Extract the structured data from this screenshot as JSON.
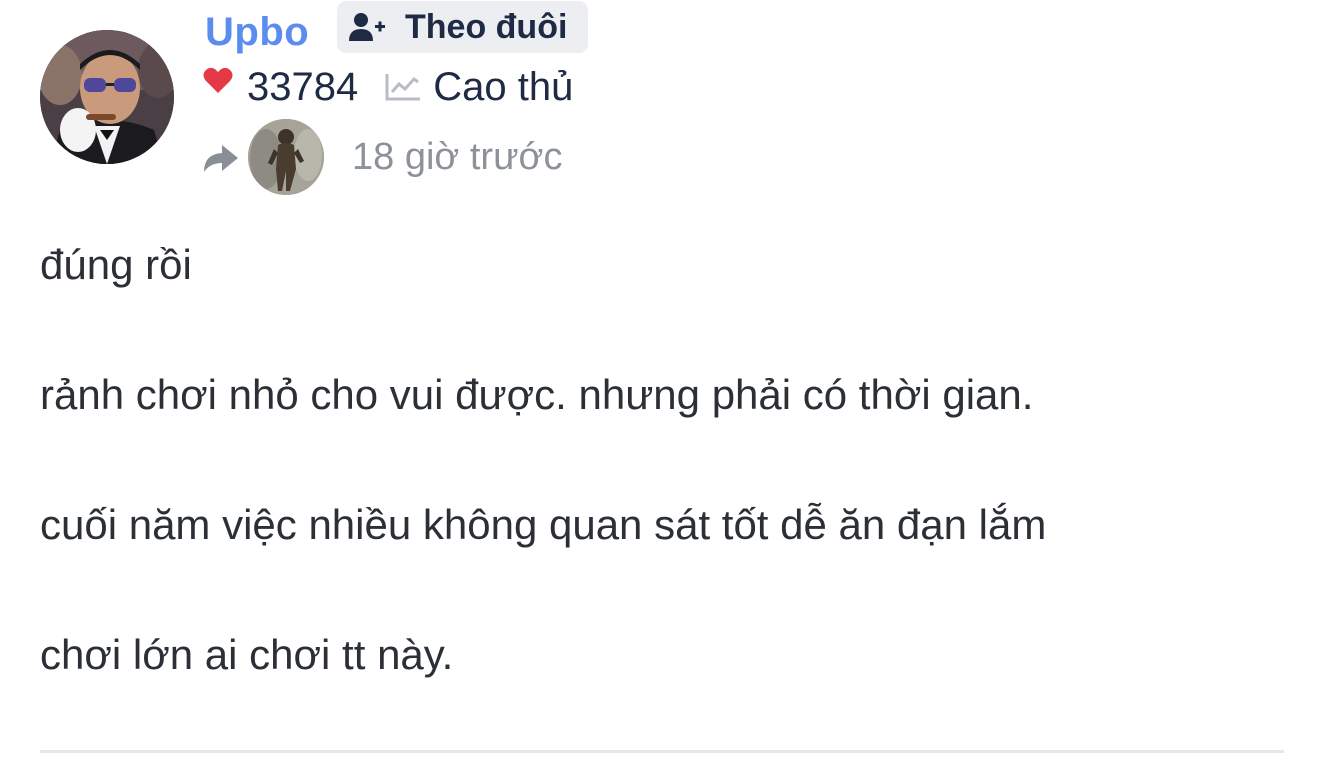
{
  "post": {
    "author": {
      "username": "Upbo",
      "follow_label": "Theo đuôi",
      "points": "33784",
      "rank": "Cao thủ",
      "avatar_icon": "user-avatar-photo"
    },
    "reply": {
      "time_ago": "18 giờ trước",
      "icon": "share-arrow-icon"
    },
    "content": {
      "paragraphs": [
        "đúng rồi",
        "rảnh chơi nhỏ cho vui được. nhưng phải có thời gian.",
        "cuối năm việc nhiều không quan sát tốt dễ ăn đạn lắm",
        "chơi lớn ai chơi tt này."
      ]
    }
  },
  "colors": {
    "username": "#5b8def",
    "heart": "#e53945",
    "text": "#1f2a44",
    "muted": "#8d929a",
    "button_bg": "#eceef2",
    "divider": "#e5e7eb"
  }
}
